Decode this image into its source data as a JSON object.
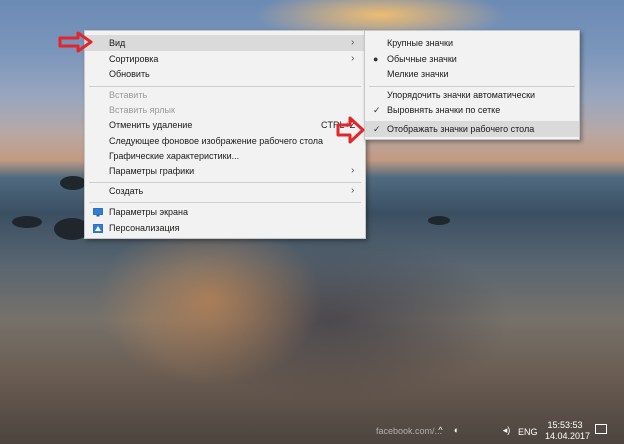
{
  "context_menu": {
    "items": [
      {
        "label": "Вид",
        "submenu": true,
        "state": "highlighted"
      },
      {
        "label": "Сортировка",
        "submenu": true
      },
      {
        "label": "Обновить"
      },
      {
        "label": "Вставить",
        "disabled": true
      },
      {
        "label": "Вставить ярлык",
        "disabled": true
      },
      {
        "label": "Отменить удаление",
        "shortcut": "CTRL+Z"
      },
      {
        "label": "Следующее фоновое изображение рабочего стола"
      },
      {
        "label": "Графические характеристики..."
      },
      {
        "label": "Параметры графики",
        "submenu": true
      },
      {
        "label": "Создать",
        "submenu": true
      },
      {
        "label": "Параметры экрана",
        "icon": "display-settings-icon"
      },
      {
        "label": "Персонализация",
        "icon": "personalization-icon"
      }
    ]
  },
  "view_submenu": {
    "items": [
      {
        "label": "Крупные значки"
      },
      {
        "label": "Обычные значки",
        "selected": true
      },
      {
        "label": "Мелкие значки"
      },
      {
        "label": "Упорядочить значки автоматически"
      },
      {
        "label": "Выровнять значки по сетке",
        "checked": true
      },
      {
        "label": "Отображать значки рабочего стола",
        "checked": true,
        "state": "highlighted"
      }
    ]
  },
  "taskbar": {
    "language": "ENG",
    "time": "15:53:53",
    "date": "14.04.2017",
    "icons": [
      "chevron-up-icon",
      "network-icon",
      "volume-icon",
      "notification-icon"
    ]
  },
  "watermark": "facebook.com/...",
  "annotation_color": "#e3262b",
  "highlight_color": "#dadada"
}
